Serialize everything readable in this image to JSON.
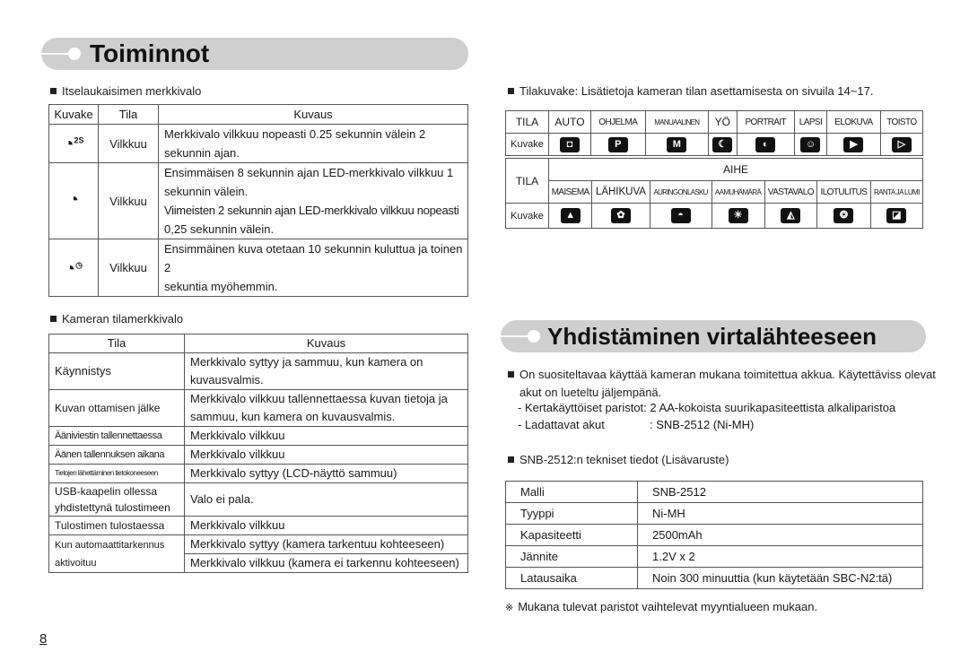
{
  "left": {
    "banner_title": "Toiminnot",
    "selftimer_section": {
      "heading": "Itselaukaisimen merkkivalo",
      "columns": [
        "Kuvake",
        "Tila",
        "Kuvaus"
      ],
      "rows": [
        {
          "icon": "timer-2s-icon",
          "icon_glyph": "◔",
          "icon_sup": "2S",
          "mode": "Vilkkuu",
          "desc": [
            "Merkkivalo vilkkuu nopeasti 0.25 sekunnin välein 2",
            "sekunnin ajan."
          ]
        },
        {
          "icon": "timer-10s-icon",
          "icon_glyph": "◔",
          "icon_sup": "",
          "mode": "Vilkkuu",
          "desc": [
            "Ensimmäisen 8 sekunnin ajan LED-merkkivalo vilkkuu 1",
            "sekunnin välein.",
            "Viimeisten 2 sekunnin ajan LED-merkkivalo vilkkuu nopeasti",
            "0,25 sekunnin välein."
          ]
        },
        {
          "icon": "timer-double-icon",
          "icon_glyph": "◔",
          "icon_sup": "◷",
          "mode": "Vilkkuu",
          "desc": [
            "Ensimmäinen kuva otetaan 10 sekunnin kuluttua ja toinen 2",
            "sekuntia myöhemmin."
          ]
        }
      ]
    },
    "status_section": {
      "heading": "Kameran tilamerkkivalo",
      "columns": [
        "Tila",
        "Kuvaus"
      ],
      "rows": [
        {
          "state": "Käynnistys",
          "desc": [
            "Merkkivalo syttyy ja sammuu, kun kamera on",
            "kuvausvalmis."
          ]
        },
        {
          "state": "Kuvan ottamisen jälke",
          "desc": [
            "Merkkivalo vilkkuu tallennettaessa kuvan tietoja ja",
            "sammuu, kun kamera on kuvausvalmis."
          ]
        },
        {
          "state": "Ääniviestin tallennettaessa",
          "desc": [
            "Merkkivalo vilkkuu"
          ]
        },
        {
          "state": "Äänen tallennuksen aikana",
          "desc": [
            "Merkkivalo vilkkuu"
          ]
        },
        {
          "state": "Tietojen lähettäminen tietokoneeseen",
          "desc": [
            "Merkkivalo syttyy (LCD-näyttö sammuu)"
          ]
        },
        {
          "state": "USB-kaapelin ollessa yhdistettynä tulostimeen",
          "state_lines": [
            "USB-kaapelin ollessa",
            "yhdistettynä tulostimeen"
          ],
          "desc": [
            "Valo ei pala."
          ]
        },
        {
          "state": "Tulostimen tulostaessa",
          "desc": [
            "Merkkivalo vilkkuu"
          ]
        },
        {
          "state": "Kun automaattitarkennus aktivoituu",
          "state_lines": [
            "Kun automaattitarkennus",
            "aktivoituu"
          ],
          "desc": [
            "Merkkivalo syttyy (kamera tarkentuu kohteeseen)",
            "Merkkivalo vilkkuu (kamera ei tarkennu kohteeseen)"
          ]
        }
      ]
    },
    "page_number": "8"
  },
  "right": {
    "mode_section": {
      "heading": "Tilakuvake: Lisätietoja kameran tilan asettamisesta on sivuila 14~17.",
      "row_label_mode": "TILA",
      "row_label_icon": "Kuvake",
      "modes": [
        {
          "label": "AUTO",
          "icon": "camera-icon",
          "glyph": "◘"
        },
        {
          "label": "OHJELMA",
          "icon": "program-camera-icon",
          "glyph": "P"
        },
        {
          "label": "MANUAALINEN",
          "icon": "manual-icon",
          "glyph": "M"
        },
        {
          "label": "YÖ",
          "icon": "night-icon",
          "glyph": "☾"
        },
        {
          "label": "PORTRAIT",
          "icon": "portrait-icon",
          "glyph": "◐"
        },
        {
          "label": "LAPSI",
          "icon": "kids-icon",
          "glyph": "☺"
        },
        {
          "label": "ELOKUVA",
          "icon": "movie-camera-icon",
          "glyph": "▶"
        },
        {
          "label": "TOISTO",
          "icon": "playback-icon",
          "glyph": "▷"
        }
      ],
      "scene_header": "AIHE",
      "scenes": [
        {
          "label": "MAISEMA",
          "icon": "landscape-icon",
          "glyph": "▲"
        },
        {
          "label": "LÄHIKUVA",
          "icon": "closeup-flower-icon",
          "glyph": "✿"
        },
        {
          "label": "AURINGONLASKU",
          "icon": "sunset-icon",
          "glyph": "◓"
        },
        {
          "label": "AAMUHÄMÄRÄ",
          "icon": "dawn-icon",
          "glyph": "☀"
        },
        {
          "label": "VASTAVALO",
          "icon": "backlight-icon",
          "glyph": "◭"
        },
        {
          "label": "ILOTULITUS",
          "icon": "fireworks-icon",
          "glyph": "❂"
        },
        {
          "label": "RANTA JA LUMI",
          "icon": "beach-snow-icon",
          "glyph": "◪"
        }
      ]
    },
    "banner_title": "Yhdistäminen virtalähteeseen",
    "power_section": {
      "intro_lines": [
        "On suositeltavaa käyttää kameran mukana toimitettua akkua. Käytettäviss olevat",
        "akut on lueteltu jäljempänä."
      ],
      "items": [
        {
          "label": "- Kertakäyttöiset paristot",
          "value": ": 2 AA-kokoista suurikapasiteettista alkaliparistoa"
        },
        {
          "label": "- Ladattavat akut",
          "value": ": SNB-2512 (Ni-MH)"
        }
      ]
    },
    "spec_section": {
      "heading": "SNB-2512:n tekniset tiedot (Lisävaruste)",
      "rows": [
        {
          "key": "Malli",
          "value": "SNB-2512"
        },
        {
          "key": "Tyyppi",
          "value": "Ni-MH"
        },
        {
          "key": "Kapasiteetti",
          "value": "2500mAh"
        },
        {
          "key": "Jännite",
          "value": "1.2V x 2"
        },
        {
          "key": "Latausaika",
          "value": "Noin 300 minuuttia (kun käytetään SBC-N2:tä)"
        }
      ]
    },
    "footnote_mark": "※",
    "footnote": "Mukana tulevat paristot vaihtelevat myyntialueen mukaan."
  }
}
